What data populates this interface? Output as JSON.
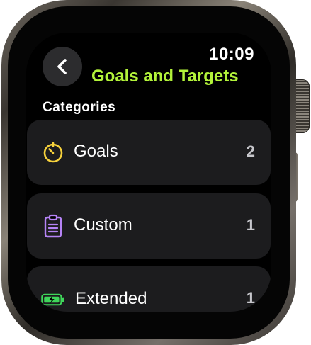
{
  "status": {
    "time": "10:09"
  },
  "header": {
    "title": "Goals and Targets",
    "back_icon": "chevron-left-icon"
  },
  "section": {
    "label": "Categories"
  },
  "categories": [
    {
      "label": "Goals",
      "count": "2",
      "icon": "timer-icon",
      "icon_color": "#f7d23c"
    },
    {
      "label": "Custom",
      "count": "1",
      "icon": "clipboard-icon",
      "icon_color": "#b583f5"
    },
    {
      "label": "Extended",
      "count": "1",
      "icon": "battery-charging-icon",
      "icon_color": "#3fd65a"
    }
  ],
  "colors": {
    "title": "#b2f23a",
    "row_background": "#1c1c1e",
    "screen_background": "#000000"
  }
}
